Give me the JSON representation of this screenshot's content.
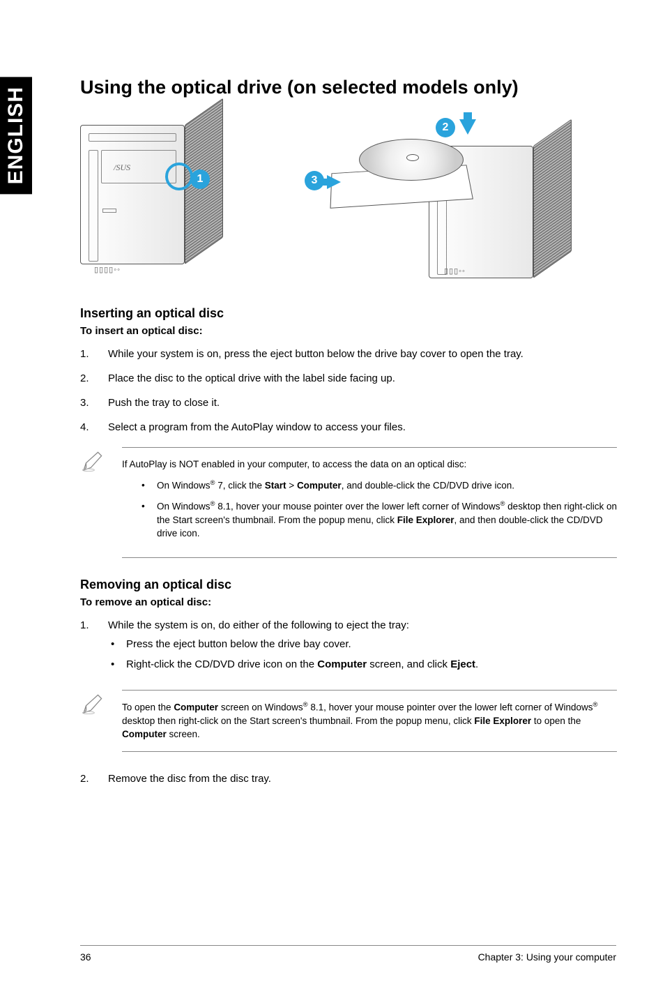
{
  "sideTab": "ENGLISH",
  "title": "Using the optical drive (on selected models only)",
  "figureBadges": {
    "b1": "1",
    "b2": "2",
    "b3": "3"
  },
  "figureLogo": "ASUS",
  "insert": {
    "heading": "Inserting an optical disc",
    "instruction": "To insert an optical disc:",
    "steps": [
      {
        "n": "1.",
        "text": "While your system is on, press the eject button below the drive bay cover to open the tray."
      },
      {
        "n": "2.",
        "text": "Place the disc to the optical drive with the label side facing up."
      },
      {
        "n": "3.",
        "text": "Push the tray to close it."
      },
      {
        "n": "4.",
        "text": "Select a program from the AutoPlay window to access your files."
      }
    ]
  },
  "note1": {
    "intro": "If AutoPlay is NOT enabled in your computer, to access the data on an optical disc:",
    "b1_pre": "On Windows",
    "b1_sup": "®",
    "b1_mid1": " 7, click the ",
    "b1_start": "Start",
    "b1_gt": " > ",
    "b1_computer": "Computer",
    "b1_post": ", and double-click the CD/DVD drive icon.",
    "b2_pre": "On Windows",
    "b2_sup1": "®",
    "b2_mid": " 8.1, hover your mouse pointer over the lower left corner of Windows",
    "b2_sup2": "®",
    "b2_mid2": " desktop then right-click on the Start screen's thumbnail. From the popup menu, click ",
    "b2_fe": "File Explorer",
    "b2_post": ", and then double-click the CD/DVD drive icon."
  },
  "remove": {
    "heading": "Removing an optical disc",
    "instruction": "To remove an optical disc:",
    "step1n": "1.",
    "step1text": "While the system is on, do either of the following to eject the tray:",
    "bullet1": "Press the eject button below the drive bay cover.",
    "bullet2_pre": "Right-click the CD/DVD drive icon on the ",
    "bullet2_comp": "Computer",
    "bullet2_mid": " screen, and click ",
    "bullet2_eject": "Eject",
    "bullet2_post": ".",
    "step2n": "2.",
    "step2text": "Remove the disc from the disc tray."
  },
  "note2": {
    "pre": "To open the ",
    "comp1": "Computer",
    "mid1": " screen on Windows",
    "sup1": "®",
    "mid2": " 8.1, hover your mouse pointer over the lower left corner of Windows",
    "sup2": "®",
    "mid3": " desktop then right-click on the Start screen's thumbnail. From the popup menu, click ",
    "fe": "File Explorer",
    "mid4": " to open the ",
    "comp2": "Computer",
    "post": " screen."
  },
  "footer": {
    "page": "36",
    "chapter": "Chapter 3: Using your computer"
  }
}
